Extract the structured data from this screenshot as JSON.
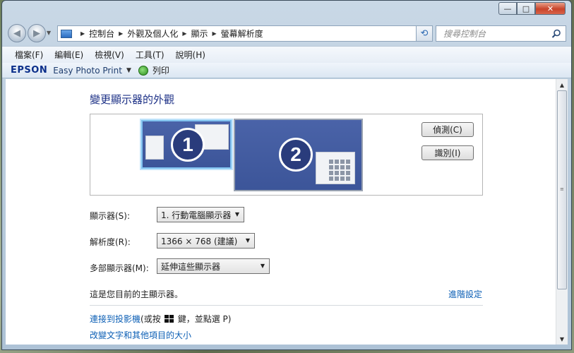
{
  "window": {
    "caption": {
      "min_glyph": "—",
      "max_glyph": "□",
      "close_glyph": "✕"
    }
  },
  "address": {
    "crumbs": [
      "控制台",
      "外觀及個人化",
      "顯示",
      "螢幕解析度"
    ]
  },
  "search": {
    "placeholder": "搜尋控制台"
  },
  "menu": {
    "items": [
      "檔案(F)",
      "編輯(E)",
      "檢視(V)",
      "工具(T)",
      "說明(H)"
    ]
  },
  "toolbar": {
    "brand": "EPSON",
    "app": "Easy Photo Print",
    "print_label": "列印"
  },
  "main": {
    "title": "變更顯示器的外觀",
    "monitors": [
      "1",
      "2"
    ],
    "detect_label": "偵測(C)",
    "identify_label": "識別(I)",
    "display_label": "顯示器(S):",
    "display_value": "1. 行動電腦顯示器",
    "resolution_label": "解析度(R):",
    "resolution_value": "1366 × 768 (建議)",
    "multi_label": "多部顯示器(M):",
    "multi_value": "延伸這些顯示器",
    "primary_note": "這是您目前的主顯示器。",
    "advanced_link": "進階設定",
    "projector_link": "連接到投影機",
    "projector_hint_pre": " (或按 ",
    "projector_hint_post": " 鍵，並點選 P)",
    "textsize_link": "改變文字和其他項目的大小"
  },
  "colors": {
    "accent_title": "#1e3287",
    "link": "#0c5fb5",
    "monitor_fill": "#4a63a8",
    "selected_border": "#7fc1ef"
  }
}
